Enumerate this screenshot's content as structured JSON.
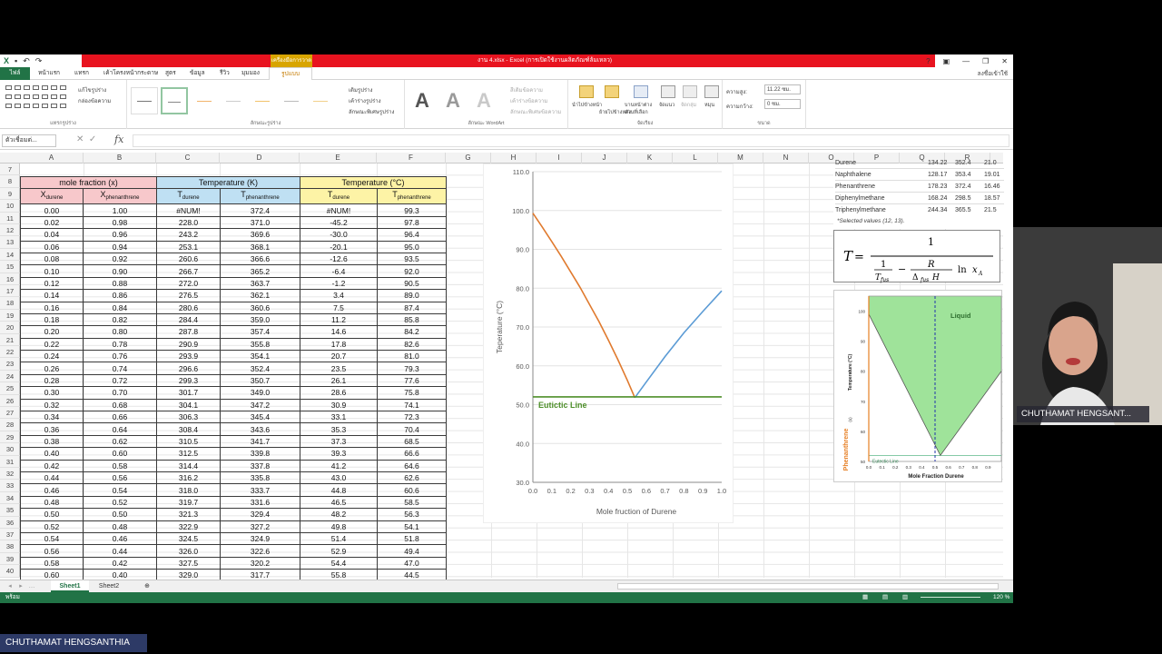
{
  "window": {
    "title": "งาน 4.xlsx - Excel (การเปิดใช้งานผลิตภัณฑ์ล้มเหลว)",
    "context_tab": "เครื่องมือการวาด",
    "user": "ลงชื่อเข้าใช้"
  },
  "ribbon_tabs": [
    "ไฟล์",
    "หน้าแรก",
    "แทรก",
    "เค้าโครงหน้ากระดาษ",
    "สูตร",
    "ข้อมูล",
    "รีวิว",
    "มุมมอง",
    "รูปแบบ"
  ],
  "ribbon": {
    "groups": [
      "แทรกรูปร่าง",
      "ลักษณะรูปร่าง",
      "ลักษณะ WordArt",
      "จัดเรียง",
      "ขนาด"
    ],
    "edit_shape": "แก้ไขรูปร่าง",
    "text_box": "กล่องข้อความ",
    "shape_fill": "เติมรูปร่าง",
    "shape_outline": "เค้าร่างรูปร่าง",
    "shape_effects": "ลักษณะพิเศษรูปร่าง",
    "text_fill": "สีเติมข้อความ",
    "text_outline": "เค้าร่างข้อความ",
    "text_effects": "ลักษณะพิเศษข้อความ",
    "bring_forward": "นำไปข้างหน้า",
    "send_backward": "ย้ายไปข้างหลัง",
    "selection_pane": "บานหน้าต่างส่วนที่เลือก",
    "align": "จัดแนว",
    "group": "จัดกลุ่ม",
    "rotate": "หมุน",
    "height_label": "ความสูง:",
    "height_value": "11.22 ซม.",
    "width_label": "ความกว้าง:",
    "width_value": "0 ซม."
  },
  "formula_bar": {
    "name_box": "ตัวเชื่อมต่...",
    "fx": "fx",
    "value": ""
  },
  "columns": [
    "A",
    "B",
    "C",
    "D",
    "E",
    "F",
    "G",
    "H",
    "I",
    "J",
    "K",
    "L",
    "M",
    "N",
    "O",
    "P",
    "Q",
    "R"
  ],
  "rows": [
    "7",
    "8",
    "9",
    "10",
    "11",
    "12",
    "13",
    "14",
    "15",
    "16",
    "17",
    "18",
    "19",
    "20",
    "21",
    "22",
    "23",
    "24",
    "25",
    "26",
    "27",
    "28",
    "29",
    "30",
    "31",
    "32",
    "33",
    "34",
    "35",
    "36",
    "37",
    "38",
    "39",
    "40"
  ],
  "table": {
    "header1": {
      "mole": "mole fraction (x)",
      "tempK": "Temperature (K)",
      "tempC": "Temperature (°C)"
    },
    "header2": {
      "xd": "X",
      "xd_sub": "durene",
      "xp": "X",
      "xp_sub": "phenanthrene",
      "tdK": "T",
      "tdK_sub": "durene",
      "tpK": "T",
      "tpK_sub": "phenanthrene",
      "tdC": "T",
      "tdC_sub": "durene",
      "tpC": "T",
      "tpC_sub": "phenanthrene"
    },
    "rows": [
      [
        "0.00",
        "1.00",
        "#NUM!",
        "372.4",
        "#NUM!",
        "99.3"
      ],
      [
        "0.02",
        "0.98",
        "228.0",
        "371.0",
        "-45.2",
        "97.8"
      ],
      [
        "0.04",
        "0.96",
        "243.2",
        "369.6",
        "-30.0",
        "96.4"
      ],
      [
        "0.06",
        "0.94",
        "253.1",
        "368.1",
        "-20.1",
        "95.0"
      ],
      [
        "0.08",
        "0.92",
        "260.6",
        "366.6",
        "-12.6",
        "93.5"
      ],
      [
        "0.10",
        "0.90",
        "266.7",
        "365.2",
        "-6.4",
        "92.0"
      ],
      [
        "0.12",
        "0.88",
        "272.0",
        "363.7",
        "-1.2",
        "90.5"
      ],
      [
        "0.14",
        "0.86",
        "276.5",
        "362.1",
        "3.4",
        "89.0"
      ],
      [
        "0.16",
        "0.84",
        "280.6",
        "360.6",
        "7.5",
        "87.4"
      ],
      [
        "0.18",
        "0.82",
        "284.4",
        "359.0",
        "11.2",
        "85.8"
      ],
      [
        "0.20",
        "0.80",
        "287.8",
        "357.4",
        "14.6",
        "84.2"
      ],
      [
        "0.22",
        "0.78",
        "290.9",
        "355.8",
        "17.8",
        "82.6"
      ],
      [
        "0.24",
        "0.76",
        "293.9",
        "354.1",
        "20.7",
        "81.0"
      ],
      [
        "0.26",
        "0.74",
        "296.6",
        "352.4",
        "23.5",
        "79.3"
      ],
      [
        "0.28",
        "0.72",
        "299.3",
        "350.7",
        "26.1",
        "77.6"
      ],
      [
        "0.30",
        "0.70",
        "301.7",
        "349.0",
        "28.6",
        "75.8"
      ],
      [
        "0.32",
        "0.68",
        "304.1",
        "347.2",
        "30.9",
        "74.1"
      ],
      [
        "0.34",
        "0.66",
        "306.3",
        "345.4",
        "33.1",
        "72.3"
      ],
      [
        "0.36",
        "0.64",
        "308.4",
        "343.6",
        "35.3",
        "70.4"
      ],
      [
        "0.38",
        "0.62",
        "310.5",
        "341.7",
        "37.3",
        "68.5"
      ],
      [
        "0.40",
        "0.60",
        "312.5",
        "339.8",
        "39.3",
        "66.6"
      ],
      [
        "0.42",
        "0.58",
        "314.4",
        "337.8",
        "41.2",
        "64.6"
      ],
      [
        "0.44",
        "0.56",
        "316.2",
        "335.8",
        "43.0",
        "62.6"
      ],
      [
        "0.46",
        "0.54",
        "318.0",
        "333.7",
        "44.8",
        "60.6"
      ],
      [
        "0.48",
        "0.52",
        "319.7",
        "331.6",
        "46.5",
        "58.5"
      ],
      [
        "0.50",
        "0.50",
        "321.3",
        "329.4",
        "48.2",
        "56.3"
      ],
      [
        "0.52",
        "0.48",
        "322.9",
        "327.2",
        "49.8",
        "54.1"
      ],
      [
        "0.54",
        "0.46",
        "324.5",
        "324.9",
        "51.4",
        "51.8"
      ],
      [
        "0.56",
        "0.44",
        "326.0",
        "322.6",
        "52.9",
        "49.4"
      ],
      [
        "0.58",
        "0.42",
        "327.5",
        "320.2",
        "54.4",
        "47.0"
      ],
      [
        "0.60",
        "0.40",
        "329.0",
        "317.7",
        "55.8",
        "44.5"
      ]
    ]
  },
  "chart_data": {
    "type": "line",
    "title": "",
    "xlabel": "Mole fruction of Durene",
    "ylabel": "Teperature (°C)",
    "xlim": [
      0.0,
      1.0
    ],
    "ylim": [
      30.0,
      110.0
    ],
    "xticks": [
      "0.0",
      "0.1",
      "0.2",
      "0.3",
      "0.4",
      "0.5",
      "0.6",
      "0.7",
      "0.8",
      "0.9",
      "1.0"
    ],
    "yticks": [
      "30.0",
      "40.0",
      "50.0",
      "60.0",
      "70.0",
      "80.0",
      "90.0",
      "100.0",
      "110.0"
    ],
    "annotation": "Eutictic Line",
    "eutectic_temperature": 52.0,
    "grid": "horizontal",
    "series": [
      {
        "color": "#e07a2e",
        "x": [
          0.0,
          0.05,
          0.1,
          0.15,
          0.2,
          0.25,
          0.3,
          0.35,
          0.4,
          0.45,
          0.5,
          0.54
        ],
        "y": [
          99.3,
          95.7,
          92.0,
          88.2,
          84.2,
          80.2,
          75.8,
          71.4,
          66.6,
          61.6,
          56.3,
          51.8
        ]
      },
      {
        "color": "#5b9bd5",
        "x": [
          0.54,
          0.6,
          0.7,
          0.8,
          0.9,
          1.0
        ],
        "y": [
          51.8,
          55.8,
          62.4,
          68.5,
          74.0,
          79.3
        ]
      },
      {
        "color": "#4e8f2a",
        "x": [
          0.0,
          1.0
        ],
        "y": [
          52.0,
          52.0
        ]
      }
    ]
  },
  "reference_table": [
    [
      "Durene",
      "134.22",
      "352.4",
      "21.0"
    ],
    [
      "Naphthalene",
      "128.17",
      "353.4",
      "19.01"
    ],
    [
      "Phenanthrene",
      "178.23",
      "372.4",
      "16.46"
    ],
    [
      "Diphenylmethane",
      "168.24",
      "298.5",
      "18.57"
    ],
    [
      "Triphenylmethane",
      "244.34",
      "365.5",
      "21.5"
    ]
  ],
  "reference_note": "*Selected values (12, 13).",
  "pasted_image": {
    "liquid_label": "Liquid",
    "eutectic_label": "Eutectic Line",
    "ylabel": "Temperature (°C)",
    "side_label": "Phenanthrene",
    "side_value": "(s)",
    "xlabel": "Mole Fraction Durene",
    "yticks": [
      "100",
      "90",
      "80",
      "70",
      "60",
      "50"
    ],
    "xticks": [
      "0.0",
      "0.1",
      "0.2",
      "0.3",
      "0.4",
      "0.5",
      "0.6",
      "0.7",
      "0.8",
      "0.9"
    ]
  },
  "sheets": [
    "Sheet1",
    "Sheet2"
  ],
  "status": {
    "ready": "พร้อม",
    "zoom": "120 %"
  },
  "participants": {
    "webcam_name": "CHUTHAMAT HENGSANT...",
    "screen_share_name": "CHUTHAMAT HENGSANTHIA"
  },
  "colors": {
    "excel_green": "#217346",
    "title_red": "#e8131f",
    "series_orange": "#e07a2e",
    "series_blue": "#5b9bd5",
    "eutectic_green": "#4e8f2a",
    "liquid_green": "#9fe39a"
  }
}
